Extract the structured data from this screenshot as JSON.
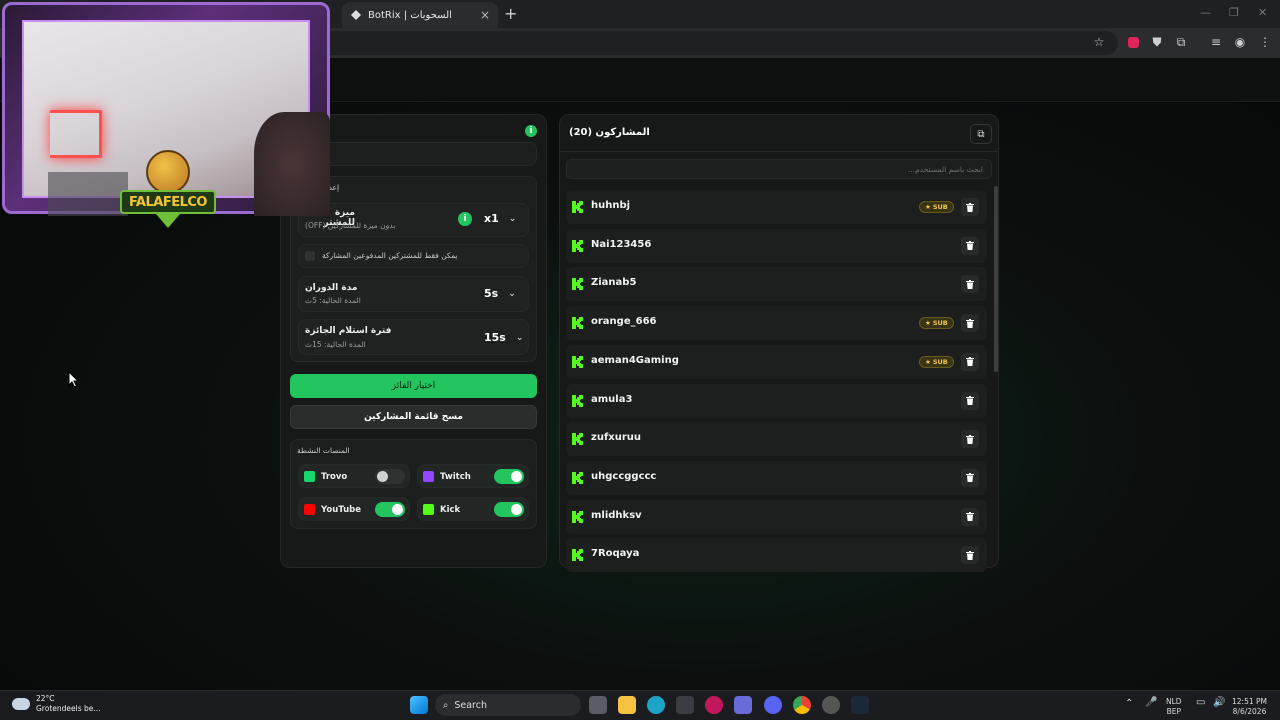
{
  "browser": {
    "tab_title": "BotRix | السحوبات",
    "new_tab": "+",
    "tab_close": "×"
  },
  "settings": {
    "feature_label": "ميزة للمشتر",
    "feature_sub": "بدون ميزة للمشاركين (OFF)",
    "feature_value": "x1",
    "paid_only_label": "يمكن فقط للمشتركين المدفوعين المشاركة",
    "spin_label": "مدة الدوران",
    "spin_sub": "المدة الحالية: 5ث",
    "spin_value": "5s",
    "claim_label": "فترة استلام الجائزة",
    "claim_sub": "المدة الحالية: 15ث",
    "claim_value": "15s",
    "section_heading": "إعدادات",
    "pick_winner": "اختيار الفائز",
    "clear_list": "مسح قائمة المشاركين",
    "platforms_heading": "المنصات النشطة",
    "platforms": [
      {
        "name": "Trovo",
        "on": false,
        "color": "#19d66b"
      },
      {
        "name": "Twitch",
        "on": true,
        "color": "#9146ff"
      },
      {
        "name": "YouTube",
        "on": true,
        "color": "#ff0000"
      },
      {
        "name": "Kick",
        "on": true,
        "color": "#53fc18"
      }
    ]
  },
  "participants": {
    "title": "المشاركون (20)",
    "search_placeholder": "ابحث باسم المستخدم...",
    "sub_badge": "SUB",
    "list": [
      {
        "name": "huhnbj",
        "sub": true
      },
      {
        "name": "Nai123456",
        "sub": false
      },
      {
        "name": "Zianab5",
        "sub": false
      },
      {
        "name": "orange_666",
        "sub": true
      },
      {
        "name": "aeman4Gaming",
        "sub": true
      },
      {
        "name": "amula3",
        "sub": false
      },
      {
        "name": "zufxuruu",
        "sub": false
      },
      {
        "name": "uhgccggccc",
        "sub": false
      },
      {
        "name": "mlidhksv",
        "sub": false
      },
      {
        "name": "7Roqaya",
        "sub": false
      }
    ]
  },
  "overlay": {
    "logo_text": "FALAFELCO"
  },
  "taskbar": {
    "temp": "22°C",
    "weather": "Grotendeels be...",
    "search": "Search",
    "lang1": "NLD",
    "lang2": "BEP",
    "time": "12:51 PM",
    "date": "8/6/2026"
  },
  "colors": {
    "accent": "#22c55e",
    "kick": "#53fc18",
    "sub_gold": "#f1c84b"
  }
}
